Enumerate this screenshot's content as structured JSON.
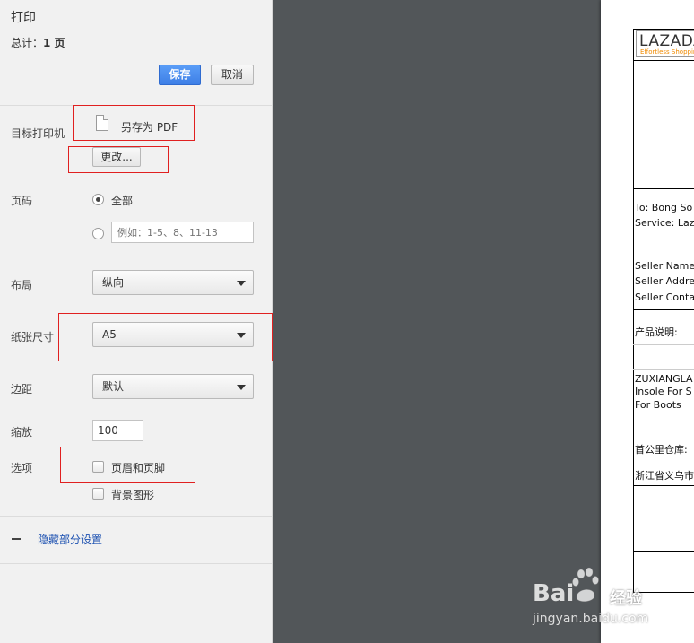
{
  "sidebar": {
    "title": "打印",
    "total_label": "总计：",
    "total_value": "1 页",
    "save_label": "保存",
    "cancel_label": "取消",
    "destination_label": "目标打印机",
    "destination_value": "另存为 PDF",
    "change_label": "更改...",
    "pages_label": "页码",
    "pages_all": "全部",
    "pages_placeholder": "例如：1-5、8、11-13",
    "layout_label": "布局",
    "layout_value": "纵向",
    "paper_size_label": "纸张尺寸",
    "paper_size_value": "A5",
    "margins_label": "边距",
    "margins_value": "默认",
    "scale_label": "缩放",
    "scale_value": "100",
    "options_label": "选项",
    "option_headers": "页眉和页脚",
    "option_background": "背景图形",
    "less_settings": "隐藏部分设置"
  },
  "preview": {
    "logo": "LAZADA",
    "logo_sub": "Effortless Shopping",
    "to": "To: Bong So",
    "service": "Service: Laz",
    "seller_name": "Seller Name",
    "seller_address": "Seller Addre",
    "seller_contact": "Seller Conta",
    "product_desc": "产品说明:",
    "item_line1": "ZUXIANGLA",
    "item_line2": "Insole For S",
    "item_line3": "For Boots",
    "first_mile": "首公里仓库:",
    "address": "浙江省义乌市"
  },
  "watermark": {
    "brand": "Bai",
    "brand2": "经验",
    "url": "jingyan.baidu.com"
  },
  "colors": {
    "save_button": "#4a8af4",
    "annotation_red": "#e02020",
    "preview_bg": "#525659"
  }
}
